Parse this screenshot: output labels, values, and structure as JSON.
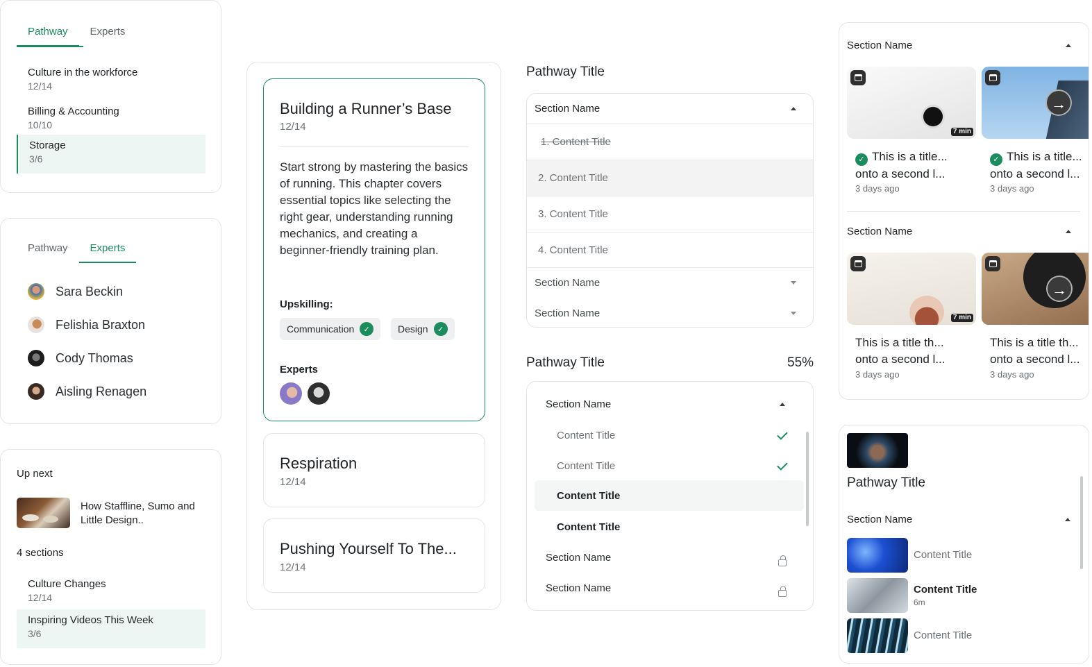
{
  "panel_pathway": {
    "tabs": [
      "Pathway",
      "Experts"
    ],
    "items": [
      {
        "title": "Culture in the workforce",
        "progress": "12/14"
      },
      {
        "title": "Billing & Accounting",
        "progress": "10/10"
      },
      {
        "title": "Storage",
        "progress": "3/6"
      }
    ]
  },
  "panel_experts": {
    "tabs": [
      "Pathway",
      "Experts"
    ],
    "experts": [
      "Sara Beckin",
      "Felishia Braxton",
      "Cody Thomas",
      "Aisling Renagen"
    ]
  },
  "panel_upnext": {
    "heading": "Up next",
    "video_title": "How Staffline, Sumo and Little Design..",
    "sections_count": "4 sections",
    "items": [
      {
        "title": "Culture Changes",
        "progress": "12/14"
      },
      {
        "title": "Inspiring Videos This Week",
        "progress": "3/6"
      }
    ]
  },
  "chapters": {
    "active": {
      "title": "Building a Runner’s Base",
      "progress": "12/14",
      "description": "Start strong by mastering the basics of running. This chapter covers essential topics like selecting the right gear, understanding running mechanics, and creating a beginner-friendly training plan.",
      "upskilling_label": "Upskilling:",
      "skills": [
        "Communication",
        "Design"
      ],
      "experts_label": "Experts"
    },
    "others": [
      {
        "title": "Respiration",
        "progress": "12/14"
      },
      {
        "title": "Pushing Yourself To The...",
        "progress": "12/14"
      }
    ]
  },
  "pathway_a": {
    "title": "Pathway Title",
    "section_open": "Section Name",
    "contents": [
      "1. Content Title",
      "2. Content Title",
      "3. Content Title",
      "4. Content Title"
    ],
    "sections_closed": [
      "Section Name",
      "Section Name"
    ]
  },
  "pathway_b": {
    "title": "Pathway Title",
    "percent": "55%",
    "section_open": "Section Name",
    "contents": [
      "Content Title",
      "Content Title",
      "Content Title",
      "Content Title"
    ],
    "locked_sections": [
      "Section Name",
      "Section Name"
    ]
  },
  "video_sections": [
    {
      "name": "Section Name",
      "cards": [
        {
          "title_line1": "This is a title...",
          "title_line2": "onto a second l...",
          "time": "3 days ago",
          "duration": "7 min"
        },
        {
          "title_line1": "This is a title...",
          "title_line2": "onto a second l...",
          "time": "3 days ago"
        }
      ]
    },
    {
      "name": "Section Name",
      "cards": [
        {
          "title_line1": "This is a title th...",
          "title_line2": "onto a second l...",
          "time": "3 days ago",
          "duration": "7 min"
        },
        {
          "title_line1": "This is a title th...",
          "title_line2": "onto a second l...",
          "time": "3 days ago"
        }
      ]
    }
  ],
  "pathway_c": {
    "title": "Pathway Title",
    "section": "Section Name",
    "items": [
      {
        "title": "Content Title",
        "meta": ""
      },
      {
        "title": "Content Title",
        "meta": "6m"
      },
      {
        "title": "Content Title",
        "meta": ""
      }
    ]
  },
  "icons": {
    "verified": "verified-badge-icon",
    "check": "check-icon",
    "lock": "lock-icon",
    "calendar": "calendar-icon",
    "arrow": "arrow-right-icon",
    "chevron_up": "chevron-up-icon",
    "chevron_down": "chevron-down-icon"
  },
  "colors": {
    "accent": "#1a8c5e",
    "selected_bg": "#eef6f3",
    "border": "#e3e5e6"
  }
}
